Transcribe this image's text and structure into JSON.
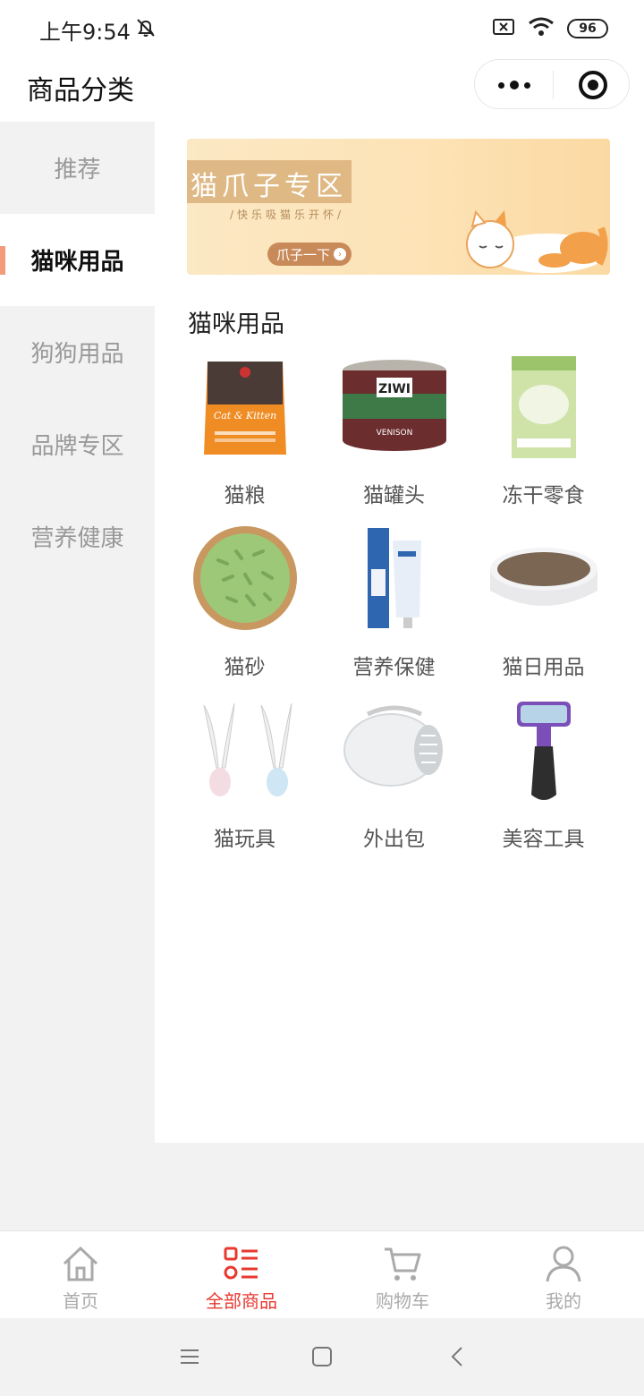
{
  "status_bar": {
    "time": "上午9:54",
    "battery": "96"
  },
  "header": {
    "title": "商品分类"
  },
  "sidebar": {
    "items": [
      {
        "label": "推荐"
      },
      {
        "label": "猫咪用品"
      },
      {
        "label": "狗狗用品"
      },
      {
        "label": "品牌专区"
      },
      {
        "label": "营养健康"
      }
    ],
    "active_index": 1
  },
  "banner": {
    "title": "猫爪子专区",
    "subtitle": "/快乐吸猫乐开怀/",
    "button": "爪子一下"
  },
  "section": {
    "title": "猫咪用品"
  },
  "products": [
    {
      "label": "猫粮",
      "icon": "cat-food-bag-icon"
    },
    {
      "label": "猫罐头",
      "icon": "cat-can-icon"
    },
    {
      "label": "冻干零食",
      "icon": "freeze-dried-snack-icon"
    },
    {
      "label": "猫砂",
      "icon": "cat-litter-icon"
    },
    {
      "label": "营养保健",
      "icon": "nutrition-tube-icon"
    },
    {
      "label": "猫日用品",
      "icon": "scratcher-bowl-icon"
    },
    {
      "label": "猫玩具",
      "icon": "feather-toy-icon"
    },
    {
      "label": "外出包",
      "icon": "pet-carrier-icon"
    },
    {
      "label": "美容工具",
      "icon": "grooming-brush-icon"
    }
  ],
  "tabbar": {
    "tabs": [
      {
        "label": "首页",
        "icon": "home-icon"
      },
      {
        "label": "全部商品",
        "icon": "category-list-icon"
      },
      {
        "label": "购物车",
        "icon": "cart-icon"
      },
      {
        "label": "我的",
        "icon": "user-icon"
      }
    ],
    "active_index": 1,
    "active_color": "#e8392f",
    "inactive_color": "#aaaaaa"
  },
  "accent": {
    "sidebar_marker": "#f39c7a"
  }
}
